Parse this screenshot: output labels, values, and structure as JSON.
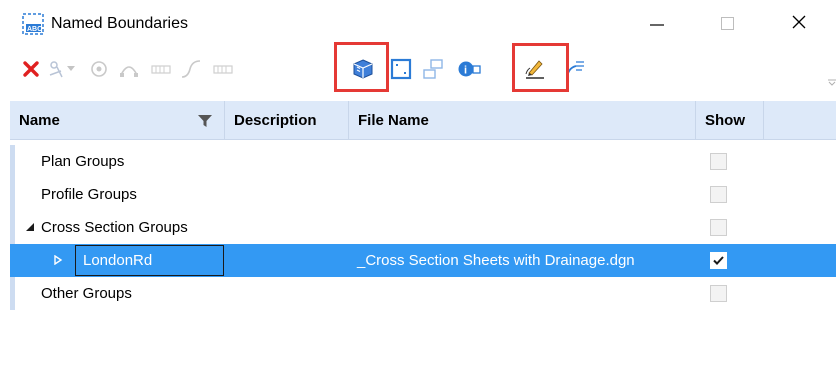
{
  "window": {
    "title": "Named Boundaries",
    "icon": "named-boundary-app-icon",
    "controls": [
      "minimize",
      "maximize",
      "close"
    ]
  },
  "toolbar": {
    "buttons": [
      {
        "name": "delete-icon",
        "enabled": true
      },
      {
        "name": "select-icon",
        "enabled": false
      },
      {
        "name": "dropdown-arrow-icon",
        "enabled": false
      },
      {
        "name": "shape-icon",
        "enabled": false
      },
      {
        "name": "arc-icon",
        "enabled": false
      },
      {
        "name": "sheet-icon",
        "enabled": false
      },
      {
        "name": "profile-curve-icon",
        "enabled": false
      },
      {
        "name": "profile-sheet-icon",
        "enabled": false
      },
      {
        "name": "cross-section-3d-icon",
        "enabled": true,
        "highlighted": true
      },
      {
        "name": "zoom-extents-icon",
        "enabled": true
      },
      {
        "name": "grouping-icon",
        "enabled": false
      },
      {
        "name": "properties-icon",
        "enabled": true
      },
      {
        "name": "edit-pencil-icon",
        "enabled": true,
        "highlighted": true
      },
      {
        "name": "path-icon",
        "enabled": true
      }
    ],
    "highlight_color": "#e53935"
  },
  "grid": {
    "columns": {
      "name": "Name",
      "description": "Description",
      "file_name": "File Name",
      "show": "Show"
    },
    "rows": [
      {
        "name": "Plan Groups",
        "description": "",
        "file_name": "",
        "show": false,
        "level": 0,
        "expander": "none"
      },
      {
        "name": "Profile Groups",
        "description": "",
        "file_name": "",
        "show": false,
        "level": 0,
        "expander": "none"
      },
      {
        "name": "Cross Section Groups",
        "description": "",
        "file_name": "",
        "show": false,
        "level": 0,
        "expander": "expanded"
      },
      {
        "name": "LondonRd",
        "description": "",
        "file_name": "_Cross Section Sheets with Drainage.dgn",
        "show": true,
        "level": 1,
        "expander": "collapsed",
        "selected": true,
        "editing": true
      },
      {
        "name": "Other Groups",
        "description": "",
        "file_name": "",
        "show": false,
        "level": 0,
        "expander": "none"
      }
    ],
    "header_bg": "#dde9f9",
    "selection_color": "#3399f3"
  }
}
